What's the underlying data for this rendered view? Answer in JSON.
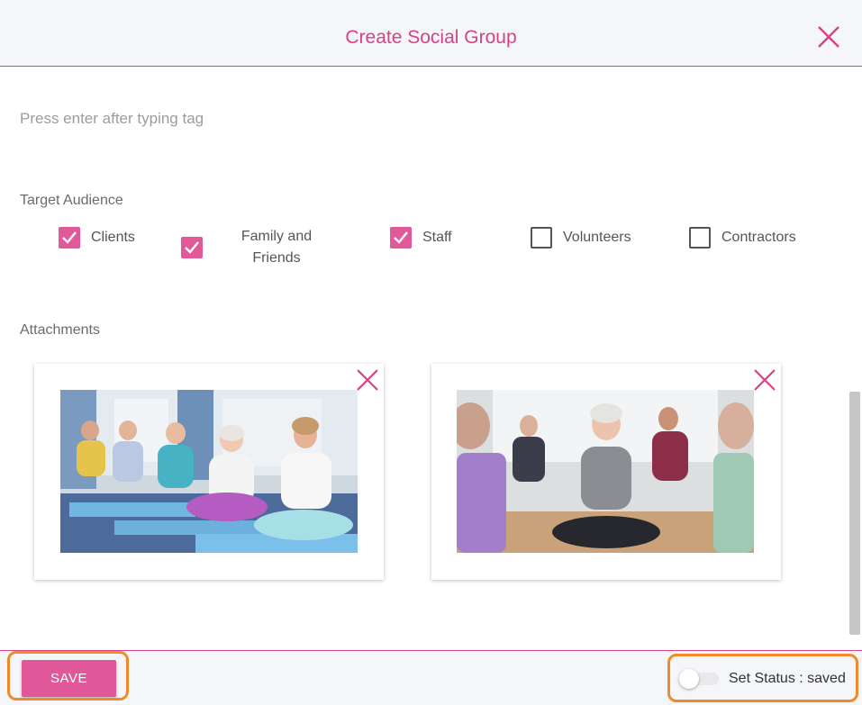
{
  "dialog": {
    "title": "Create Social Group",
    "close_icon": "close-icon"
  },
  "tags": {
    "placeholder": "Press enter after typing tag",
    "value": ""
  },
  "target_audience": {
    "label": "Target Audience",
    "options": [
      {
        "label": "Clients",
        "checked": true
      },
      {
        "label": "Family and Friends",
        "line1": "Family and",
        "line2": "Friends",
        "checked": true
      },
      {
        "label": "Staff",
        "checked": true
      },
      {
        "label": "Volunteers",
        "checked": false
      },
      {
        "label": "Contractors",
        "checked": false
      }
    ]
  },
  "attachments": {
    "label": "Attachments",
    "items": [
      {
        "description": "Group of seniors doing seated yoga meditation on blue mats",
        "remove_icon": "close-icon"
      },
      {
        "description": "Smiling senior woman sitting cross-legged in yoga class",
        "remove_icon": "close-icon"
      }
    ]
  },
  "footer": {
    "save_label": "SAVE",
    "status_label": "Set Status : saved",
    "status_toggle_on": false
  },
  "colors": {
    "accent": "#d6428a",
    "checkbox_checked": "#e2599a",
    "save_button": "#e1589a",
    "highlight": "#f08a2b",
    "header_bg": "#f5f6f9"
  }
}
